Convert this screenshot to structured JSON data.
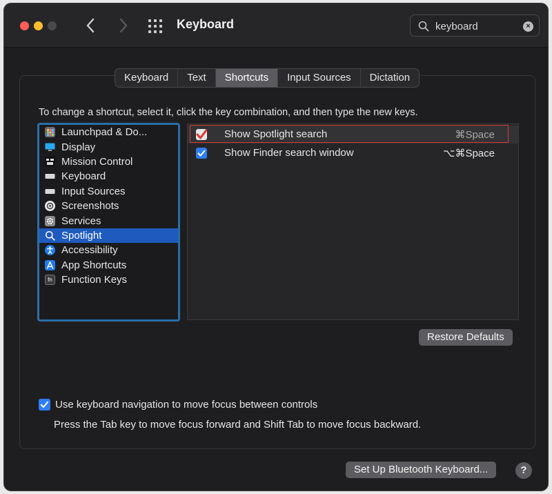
{
  "window": {
    "title": "Keyboard"
  },
  "search": {
    "value": "keyboard"
  },
  "tabs": [
    "Keyboard",
    "Text",
    "Shortcuts",
    "Input Sources",
    "Dictation"
  ],
  "active_tab": "Shortcuts",
  "instruction": "To change a shortcut, select it, click the key combination, and then type the new keys.",
  "sidebar": {
    "items": [
      {
        "label": "Launchpad & Do...",
        "icon": "launchpad-icon"
      },
      {
        "label": "Display",
        "icon": "display-icon"
      },
      {
        "label": "Mission Control",
        "icon": "mission-control-icon"
      },
      {
        "label": "Keyboard",
        "icon": "keyboard-icon"
      },
      {
        "label": "Input Sources",
        "icon": "input-sources-icon"
      },
      {
        "label": "Screenshots",
        "icon": "screenshots-icon"
      },
      {
        "label": "Services",
        "icon": "services-gear-icon"
      },
      {
        "label": "Spotlight",
        "icon": "spotlight-search-icon"
      },
      {
        "label": "Accessibility",
        "icon": "accessibility-icon"
      },
      {
        "label": "App Shortcuts",
        "icon": "app-store-icon"
      },
      {
        "label": "Function Keys",
        "icon": "fn-key-icon"
      }
    ],
    "selected": "Spotlight"
  },
  "shortcuts": [
    {
      "label": "Show Spotlight search",
      "keys": "⌘Space",
      "checked": true
    },
    {
      "label": "Show Finder search window",
      "keys": "⌥⌘Space",
      "checked": true
    }
  ],
  "buttons": {
    "restore_defaults": "Restore Defaults",
    "bluetooth": "Set Up Bluetooth Keyboard...",
    "help": "?"
  },
  "keyboard_navigation": {
    "checked": true,
    "label": "Use keyboard navigation to move focus between controls",
    "hint": "Press the Tab key to move focus forward and Shift Tab to move focus backward."
  },
  "colors": {
    "accent": "#2f7ef5",
    "selection": "#1f5bbf",
    "highlight_border": "#d83a34"
  }
}
